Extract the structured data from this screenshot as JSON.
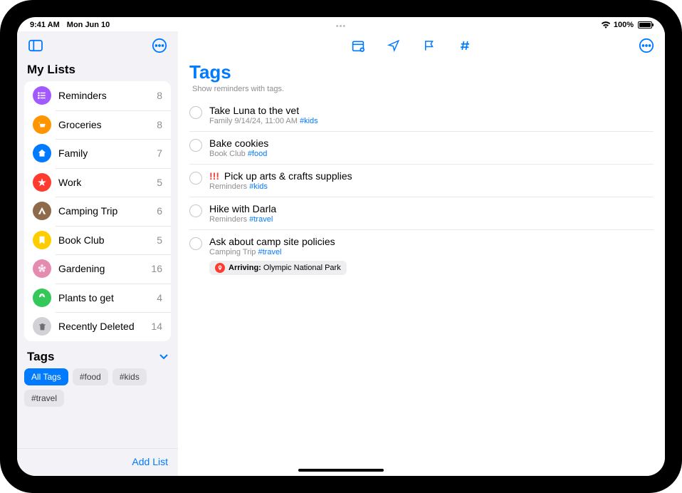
{
  "status": {
    "time": "9:41 AM",
    "date": "Mon Jun 10",
    "battery": "100%"
  },
  "sidebar": {
    "section_title": "My Lists",
    "lists": [
      {
        "name": "Reminders",
        "count": 8,
        "color": "#a259ff",
        "iconSvg": "<svg width='14' height='14' viewBox='0 0 24 24' fill='none' stroke='white' stroke-width='2.5'><line x1='8' y1='6' x2='20' y2='6'/><line x1='8' y1='12' x2='20' y2='12'/><line x1='8' y1='18' x2='20' y2='18'/><circle cx='4' cy='6' r='1' fill='white'/><circle cx='4' cy='12' r='1' fill='white'/><circle cx='4' cy='18' r='1' fill='white'/></svg>"
      },
      {
        "name": "Groceries",
        "count": 8,
        "color": "#ff9500",
        "iconSvg": "<svg width='14' height='14' viewBox='0 0 24 24' fill='white'><path d='M4 6h2l2 12h10l2-8H7'/></svg>"
      },
      {
        "name": "Family",
        "count": 7,
        "color": "#007aff",
        "iconSvg": "<svg width='14' height='14' viewBox='0 0 24 24' fill='white'><path d='M12 3l9 8h-3v9H6v-9H3z'/></svg>"
      },
      {
        "name": "Work",
        "count": 5,
        "color": "#ff3b30",
        "iconSvg": "<svg width='14' height='14' viewBox='0 0 24 24' fill='white'><path d='M12 2l2.4 7.4H22l-6 4.4 2.3 7.2L12 16.8 5.7 21l2.3-7.2-6-4.4h7.6z'/></svg>"
      },
      {
        "name": "Camping Trip",
        "count": 6,
        "color": "#8e6a4a",
        "iconSvg": "<svg width='14' height='14' viewBox='0 0 24 24' fill='white'><path d='M12 3L3 20h18z M12 10l-4 10h8z' fill-rule='evenodd'/></svg>"
      },
      {
        "name": "Book Club",
        "count": 5,
        "color": "#ffcc00",
        "iconSvg": "<svg width='14' height='14' viewBox='0 0 24 24' fill='white'><path d='M6 3v18l6-4 6 4V3z'/></svg>"
      },
      {
        "name": "Gardening",
        "count": 16,
        "color": "#e58bb0",
        "iconSvg": "<svg width='14' height='14' viewBox='0 0 24 24' fill='white'><circle cx='12' cy='12' r='3'/><circle cx='12' cy='5' r='3' opacity='0.8'/><circle cx='18' cy='10' r='3' opacity='0.8'/><circle cx='6' cy='10' r='3' opacity='0.8'/><circle cx='16' cy='17' r='3' opacity='0.8'/><circle cx='8' cy='17' r='3' opacity='0.8'/></svg>"
      },
      {
        "name": "Plants to get",
        "count": 4,
        "color": "#34c759",
        "iconSvg": "<svg width='14' height='14' viewBox='0 0 24 24' fill='white'><path d='M12 2C7 2 5 7 5 11c4 0 7-3 7-9zm0 0c5 0 7 5 7 9-4 0-7-3-7-9zm0 20v-8'/></svg>"
      },
      {
        "name": "Recently Deleted",
        "count": 14,
        "color": "#d1d1d6",
        "iconSvg": "<svg width='13' height='13' viewBox='0 0 24 24' fill='#6e6e73'><path d='M6 7h12l-1 14H7zM9 4h6v2H9zM4 6h16v2H4z'/></svg>"
      }
    ],
    "tags_title": "Tags",
    "tags": [
      {
        "label": "All Tags",
        "active": true
      },
      {
        "label": "#food",
        "active": false
      },
      {
        "label": "#kids",
        "active": false
      },
      {
        "label": "#travel",
        "active": false
      }
    ],
    "add_list": "Add List"
  },
  "main": {
    "title": "Tags",
    "subtitle": "Show reminders with tags.",
    "reminders": [
      {
        "title": "Take Luna to the vet",
        "list": "Family",
        "date": "9/14/24, 11:00 AM",
        "tags": "#kids",
        "priority": ""
      },
      {
        "title": "Bake cookies",
        "list": "Book Club",
        "date": "",
        "tags": "#food",
        "priority": ""
      },
      {
        "title": "Pick up arts & crafts supplies",
        "list": "Reminders",
        "date": "",
        "tags": "#kids",
        "priority": "!!!"
      },
      {
        "title": "Hike with Darla",
        "list": "Reminders",
        "date": "",
        "tags": "#travel",
        "priority": ""
      },
      {
        "title": "Ask about camp site policies",
        "list": "Camping Trip",
        "date": "",
        "tags": "#travel",
        "priority": "",
        "location_prefix": "Arriving:",
        "location": "Olympic National Park"
      }
    ]
  }
}
